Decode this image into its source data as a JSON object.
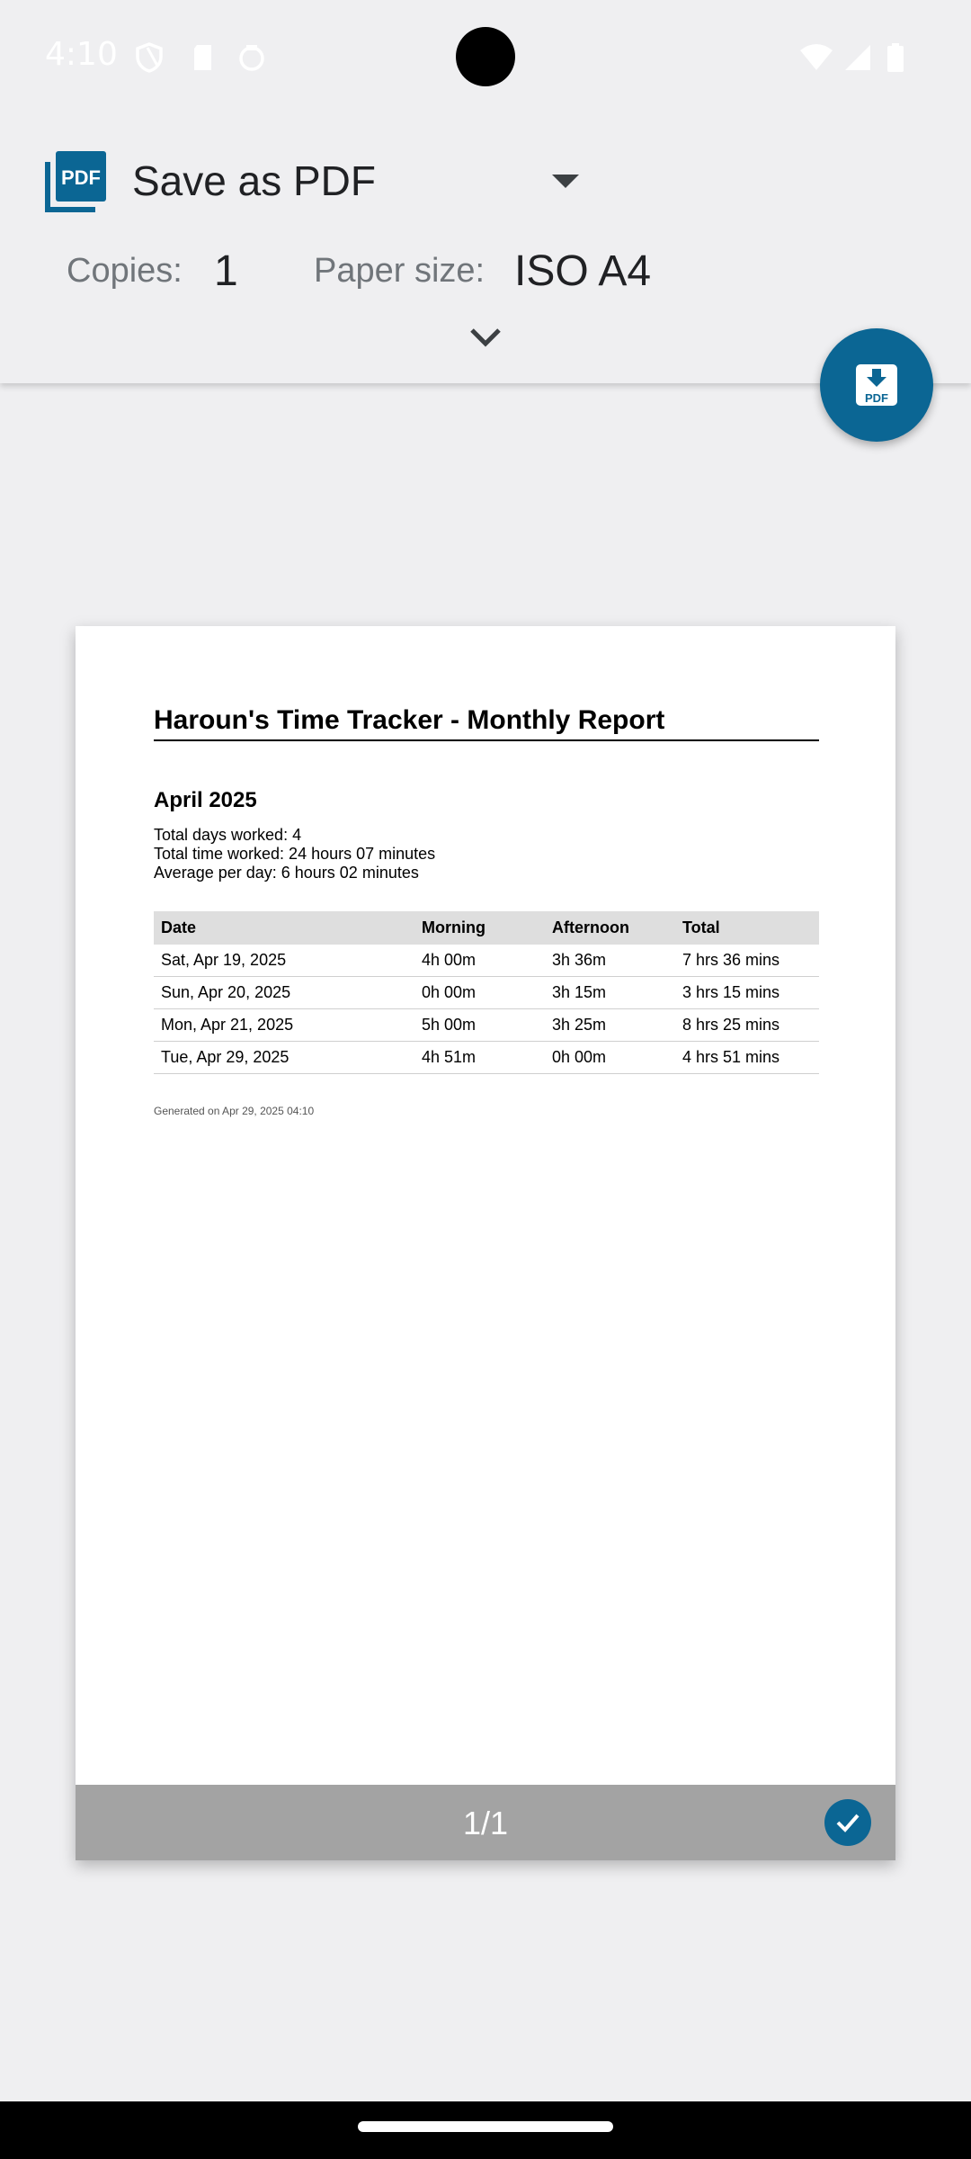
{
  "status_bar": {
    "time": "4:10"
  },
  "print_header": {
    "printer_name": "Save as PDF",
    "copies_label": "Copies:",
    "copies_value": "1",
    "paper_size_label": "Paper size:",
    "paper_size_value": "ISO A4",
    "printer_icon": "pdf-icon",
    "fab_icon": "download-pdf-icon"
  },
  "document": {
    "title": "Haroun's Time Tracker - Monthly Report",
    "month": "April 2025",
    "summary": [
      "Total days worked: 4",
      "Total time worked: 24 hours 07 minutes",
      "Average per day: 6 hours 02 minutes"
    ],
    "table": {
      "headers": [
        "Date",
        "Morning",
        "Afternoon",
        "Total"
      ],
      "rows": [
        [
          "Sat, Apr 19, 2025",
          "4h 00m",
          "3h 36m",
          "7 hrs 36 mins"
        ],
        [
          "Sun, Apr 20, 2025",
          "0h 00m",
          "3h 15m",
          "3 hrs 15 mins"
        ],
        [
          "Mon, Apr 21, 2025",
          "5h 00m",
          "3h 25m",
          "8 hrs 25 mins"
        ],
        [
          "Tue, Apr 29, 2025",
          "4h 51m",
          "0h 00m",
          "4 hrs 51 mins"
        ]
      ]
    },
    "generated": "Generated on Apr 29, 2025 04:10"
  },
  "page_footer": {
    "page_number": "1/1"
  },
  "colors": {
    "accent": "#0b6694",
    "background": "#efeff1",
    "footer": "#a3a3a3"
  }
}
